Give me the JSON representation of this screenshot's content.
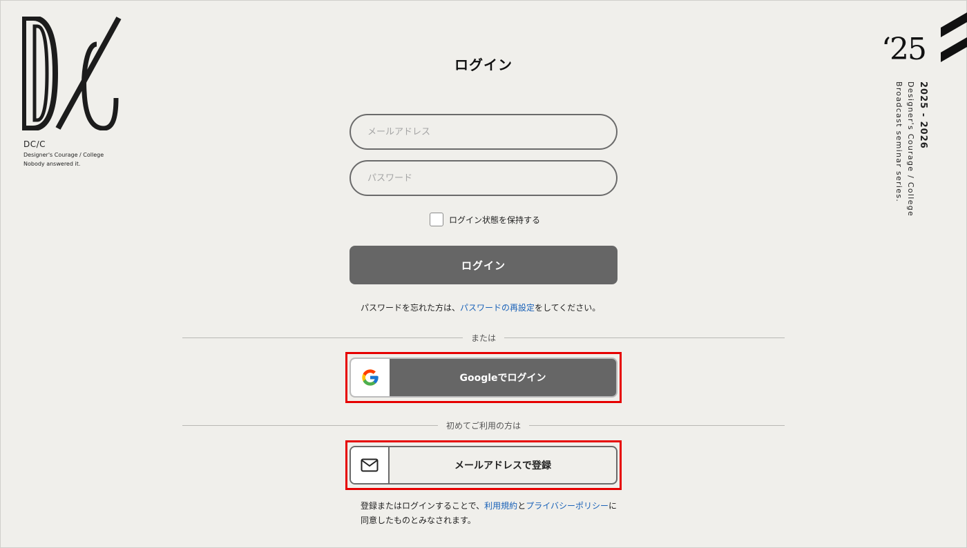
{
  "brand": {
    "name": "DC/C",
    "subtitle": "Designer's Courage / College",
    "tagline": "Nobody answered it."
  },
  "side": {
    "year": "‘25",
    "period": "2025 - 2026",
    "line1": "Designer's Courage / College",
    "line2": "Broadcast seminar series."
  },
  "login": {
    "title": "ログイン",
    "email_placeholder": "メールアドレス",
    "password_placeholder": "パスワード",
    "remember_label": "ログイン状態を保持する",
    "submit_label": "ログイン",
    "forgot_prefix": "パスワードを忘れた方は、",
    "forgot_link": "パスワードの再設定",
    "forgot_suffix": "をしてください。"
  },
  "divider_or": "または",
  "google_button": "Googleでログイン",
  "divider_first": "初めてご利用の方は",
  "email_signup_button": "メールアドレスで登録",
  "terms": {
    "prefix": "登録またはログインすることで、",
    "terms_link": "利用規約",
    "and": "と",
    "privacy_link": "プライバシーポリシー",
    "suffix": "に",
    "line2": "同意したものとみなされます。"
  },
  "colors": {
    "background": "#f0efeb",
    "button_gray": "#666666",
    "link": "#1a62b8",
    "highlight": "#e60000"
  },
  "icons": {
    "google": "google-g-icon",
    "mail": "mail-envelope-icon"
  }
}
